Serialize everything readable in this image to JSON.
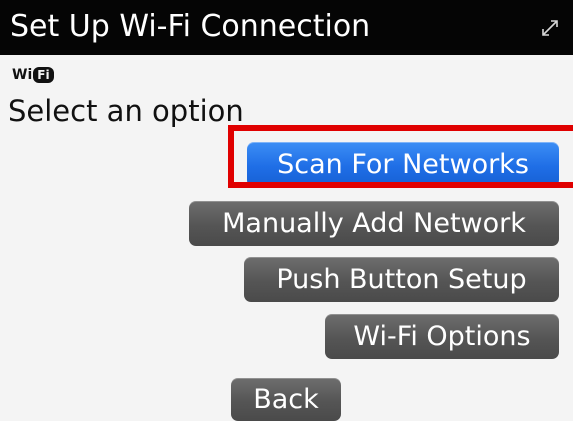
{
  "titlebar": {
    "title": "Set Up Wi-Fi Connection",
    "expand_icon": "expand-arrows-icon"
  },
  "logo": {
    "wi": "Wi",
    "fi": "Fi"
  },
  "prompt": "Select an option",
  "buttons": {
    "scan": "Scan For Networks",
    "manual": "Manually Add Network",
    "push": "Push Button Setup",
    "options": "Wi-Fi Options",
    "back": "Back"
  },
  "colors": {
    "titlebar_bg": "#050505",
    "selected_button": "#1f6ee6",
    "button": "#555555",
    "highlight_box": "#e00000"
  }
}
